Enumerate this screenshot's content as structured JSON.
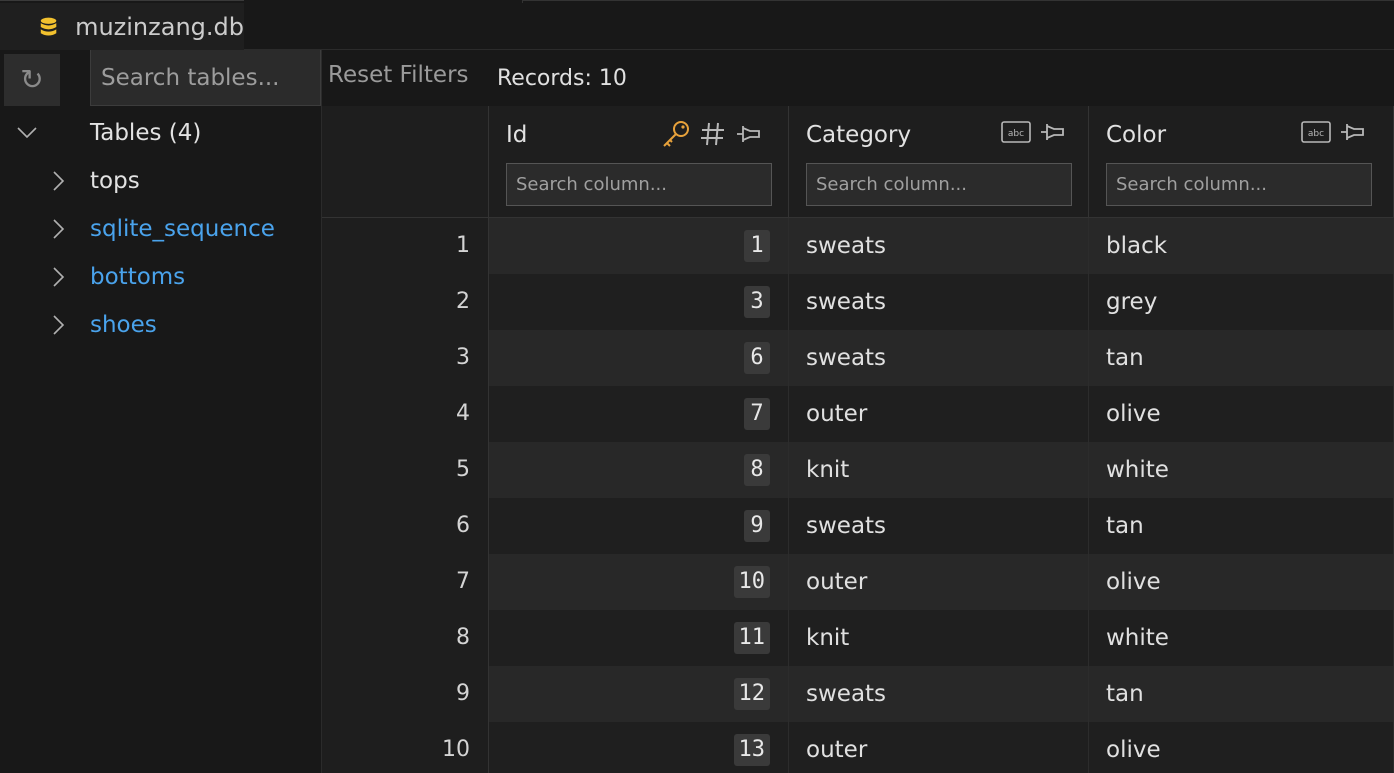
{
  "tab": {
    "label": "muzinzang.db",
    "icon": "database-icon"
  },
  "sidebar": {
    "refresh_icon": "refresh-icon",
    "search_placeholder": "Search tables...",
    "root": {
      "label": "Tables (4)",
      "expanded": true
    },
    "tables": [
      {
        "name": "tops",
        "selected": true
      },
      {
        "name": "sqlite_sequence",
        "selected": false
      },
      {
        "name": "bottoms",
        "selected": false
      },
      {
        "name": "shoes",
        "selected": false
      }
    ]
  },
  "toolbar": {
    "reset_filters": "Reset Filters",
    "records": "Records: 10"
  },
  "grid": {
    "columns": [
      {
        "title": "Id",
        "search_placeholder": "Search column...",
        "icons": [
          "key-icon",
          "hash-icon",
          "pin-icon"
        ]
      },
      {
        "title": "Category",
        "search_placeholder": "Search column...",
        "icons": [
          "text-type-icon",
          "pin-icon"
        ]
      },
      {
        "title": "Color",
        "search_placeholder": "Search column...",
        "icons": [
          "text-type-icon",
          "pin-icon"
        ]
      }
    ],
    "rows": [
      {
        "num": "1",
        "id": "1",
        "category": "sweats",
        "color": "black"
      },
      {
        "num": "2",
        "id": "3",
        "category": "sweats",
        "color": "grey"
      },
      {
        "num": "3",
        "id": "6",
        "category": "sweats",
        "color": "tan"
      },
      {
        "num": "4",
        "id": "7",
        "category": "outer",
        "color": "olive"
      },
      {
        "num": "5",
        "id": "8",
        "category": "knit",
        "color": "white"
      },
      {
        "num": "6",
        "id": "9",
        "category": "sweats",
        "color": "tan"
      },
      {
        "num": "7",
        "id": "10",
        "category": "outer",
        "color": "olive"
      },
      {
        "num": "8",
        "id": "11",
        "category": "knit",
        "color": "white"
      },
      {
        "num": "9",
        "id": "12",
        "category": "sweats",
        "color": "tan"
      },
      {
        "num": "10",
        "id": "13",
        "category": "outer",
        "color": "olive"
      }
    ]
  },
  "colors": {
    "key": "#e8a23b",
    "link": "#4aa3ec",
    "db_icon": "#f2c12e"
  }
}
